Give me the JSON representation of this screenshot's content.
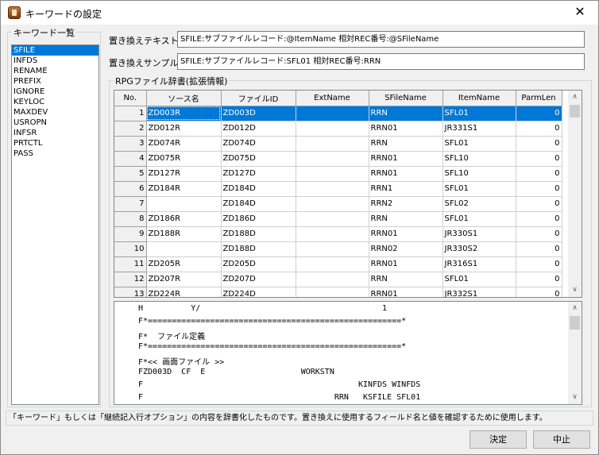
{
  "window": {
    "title": "キーワードの設定",
    "close_glyph": "✕"
  },
  "keyword_panel": {
    "legend": "キーワード一覧",
    "items": [
      "SFILE",
      "INFDS",
      "RENAME",
      "PREFIX",
      "IGNORE",
      "KEYLOC",
      "MAXDEV",
      "USROPN",
      "INFSR",
      "PRTCTL",
      "PASS"
    ],
    "selected": "SFILE"
  },
  "replace_text": {
    "label": "置き換えテキスト",
    "value": "SFILE:サブファイルレコード:@ItemName 相対REC番号:@SFileName"
  },
  "replace_sample": {
    "label": "置き換えサンプル",
    "value": "SFILE:サブファイルレコード:SFL01 相対REC番号:RRN"
  },
  "rpg_dictionary": {
    "legend": "RPGファイル辞書(拡張情報)",
    "columns": [
      "No.",
      "ソース名",
      "ファイルID",
      "ExtName",
      "SFileName",
      "ItemName",
      "ParmLen"
    ],
    "rows": [
      {
        "no": "1",
        "source": "ZD003R",
        "file_id": "ZD003D",
        "ext": "",
        "sfile": "RRN",
        "item": "SFL01",
        "len": "0"
      },
      {
        "no": "2",
        "source": "ZD012R",
        "file_id": "ZD012D",
        "ext": "",
        "sfile": "RRN01",
        "item": "JR331S1",
        "len": "0"
      },
      {
        "no": "3",
        "source": "ZD074R",
        "file_id": "ZD074D",
        "ext": "",
        "sfile": "RRN",
        "item": "SFL01",
        "len": "0"
      },
      {
        "no": "4",
        "source": "ZD075R",
        "file_id": "ZD075D",
        "ext": "",
        "sfile": "RRN01",
        "item": "SFL10",
        "len": "0"
      },
      {
        "no": "5",
        "source": "ZD127R",
        "file_id": "ZD127D",
        "ext": "",
        "sfile": "RRN01",
        "item": "SFL10",
        "len": "0"
      },
      {
        "no": "6",
        "source": "ZD184R",
        "file_id": "ZD184D",
        "ext": "",
        "sfile": "RRN1",
        "item": "SFL01",
        "len": "0"
      },
      {
        "no": "7",
        "source": "",
        "file_id": "ZD184D",
        "ext": "",
        "sfile": "RRN2",
        "item": "SFL02",
        "len": "0"
      },
      {
        "no": "8",
        "source": "ZD186R",
        "file_id": "ZD186D",
        "ext": "",
        "sfile": "RRN",
        "item": "SFL01",
        "len": "0"
      },
      {
        "no": "9",
        "source": "ZD188R",
        "file_id": "ZD188D",
        "ext": "",
        "sfile": "RRN01",
        "item": "JR330S1",
        "len": "0"
      },
      {
        "no": "10",
        "source": "",
        "file_id": "ZD188D",
        "ext": "",
        "sfile": "RRN02",
        "item": "JR330S2",
        "len": "0"
      },
      {
        "no": "11",
        "source": "ZD205R",
        "file_id": "ZD205D",
        "ext": "",
        "sfile": "RRN01",
        "item": "JR316S1",
        "len": "0"
      },
      {
        "no": "12",
        "source": "ZD207R",
        "file_id": "ZD207D",
        "ext": "",
        "sfile": "RRN",
        "item": "SFL01",
        "len": "0"
      },
      {
        "no": "13",
        "source": "ZD224R",
        "file_id": "ZD224D",
        "ext": "",
        "sfile": "RRN01",
        "item": "JR332S1",
        "len": "0"
      }
    ],
    "selected_row": 1
  },
  "source_lines": [
    "H          Y/                                      1",
    "F*=====================================================*",
    "F*  ファイル定義",
    "F*=====================================================*",
    "F*<< 画面ファイル >>",
    "FZD003D  CF  E                    WORKSTN",
    "F                                             KINFDS WINFDS",
    "F                                        RRN   KSFILE SFL01"
  ],
  "status_text": "「キーワード」もしくは「継続記入行オプション」の内容を辞書化したものです。置き換えに使用するフィールド名と値を確認するために使用します。",
  "buttons": {
    "ok": "決定",
    "cancel": "中止"
  },
  "scroll_glyphs": {
    "up": "∧",
    "down": "∨"
  }
}
